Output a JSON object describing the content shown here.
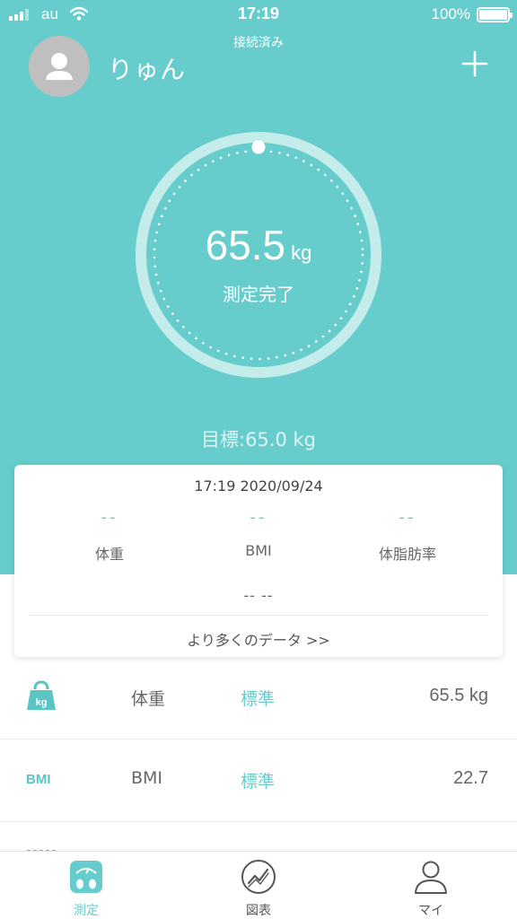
{
  "status_bar": {
    "carrier": "au",
    "time": "17:19",
    "battery": "100%"
  },
  "header": {
    "connection_status": "接続済み",
    "username": "りゅん",
    "add_icon": "plus-icon",
    "avatar_icon": "person-silhouette-icon"
  },
  "gauge": {
    "weight_value": "65.5",
    "weight_unit": "kg",
    "status": "測定完了",
    "target": "目標:65.0 kg"
  },
  "summary_card": {
    "datetime": "17:19 2020/09/24",
    "columns": [
      {
        "value": "--",
        "label": "体重"
      },
      {
        "value": "--",
        "label": "BMI"
      },
      {
        "value": "--",
        "label": "体脂肪率"
      }
    ],
    "secondary_value": "-- --",
    "more_link": "より多くのデータ >>"
  },
  "metrics": [
    {
      "icon": "kg-weight-icon",
      "icon_text": "kg",
      "name": "体重",
      "level": "標準",
      "value": "65.5 kg"
    },
    {
      "icon": "bmi-icon",
      "icon_text": "BMI",
      "name": "BMI",
      "level": "標準",
      "value": "22.7"
    }
  ],
  "tabbar": {
    "tabs": [
      {
        "label": "測定",
        "icon": "scale-icon",
        "active": true
      },
      {
        "label": "図表",
        "icon": "chart-circle-icon",
        "active": false
      },
      {
        "label": "マイ",
        "icon": "person-icon",
        "active": false
      }
    ]
  },
  "colors": {
    "accent": "#66cdcc",
    "background": "#ffffff",
    "text": "#555555"
  }
}
